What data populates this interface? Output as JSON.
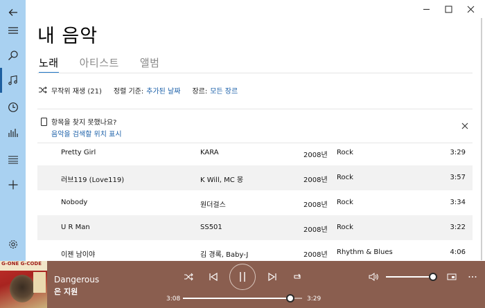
{
  "sidebar": {
    "items": [
      {
        "icon": "back-arrow-icon"
      },
      {
        "icon": "hamburger-menu-icon"
      },
      {
        "icon": "search-icon"
      },
      {
        "icon": "music-note-icon",
        "active": true
      },
      {
        "icon": "clock-icon"
      },
      {
        "icon": "equalizer-bars-icon"
      },
      {
        "icon": "playlist-icon"
      },
      {
        "icon": "plus-icon"
      },
      {
        "icon": "settings-gear-icon"
      }
    ],
    "bg_color": "#a9d1f1",
    "active_color": "#1e5fa0"
  },
  "header": {
    "title": "내 음악",
    "tabs": [
      {
        "label": "노래",
        "active": true
      },
      {
        "label": "아티스트",
        "active": false
      },
      {
        "label": "앨범",
        "active": false
      }
    ]
  },
  "filters": {
    "shuffle_label": "무작위 재생 (21)",
    "sort_label": "정렬 기준:",
    "sort_value": "추가된 날짜",
    "genre_label": "장르:",
    "genre_value": "모든 장르"
  },
  "notice": {
    "title": "항목을 찾지 못했나요?",
    "link": "음악을 검색할 위치 표시"
  },
  "songs": [
    {
      "title": "Pretty Girl",
      "artist": "KARA",
      "year": "2008년",
      "genre": "Rock",
      "duration": "3:29"
    },
    {
      "title": "러브119 (Love119)",
      "artist": "K Will, MC 몽",
      "year": "2008년",
      "genre": "Rock",
      "duration": "3:57"
    },
    {
      "title": "Nobody",
      "artist": "원더걸스",
      "year": "2008년",
      "genre": "Rock",
      "duration": "3:34"
    },
    {
      "title": "U R Man",
      "artist": "SS501",
      "year": "2008년",
      "genre": "Rock",
      "duration": "3:22"
    },
    {
      "title": "이젠 남이야",
      "artist": "김 경록, Baby-J",
      "year": "2008년",
      "genre": "Rhythm & Blues",
      "duration": "4:06"
    }
  ],
  "player": {
    "song_title": "Dangerous",
    "song_artist": "은 지원",
    "album_art_text": "G-ONE G-CODE",
    "current_time": "3:08",
    "total_time": "3:29",
    "progress": 0.9,
    "volume": 1.0,
    "bg_color": "#8a5e4f"
  }
}
